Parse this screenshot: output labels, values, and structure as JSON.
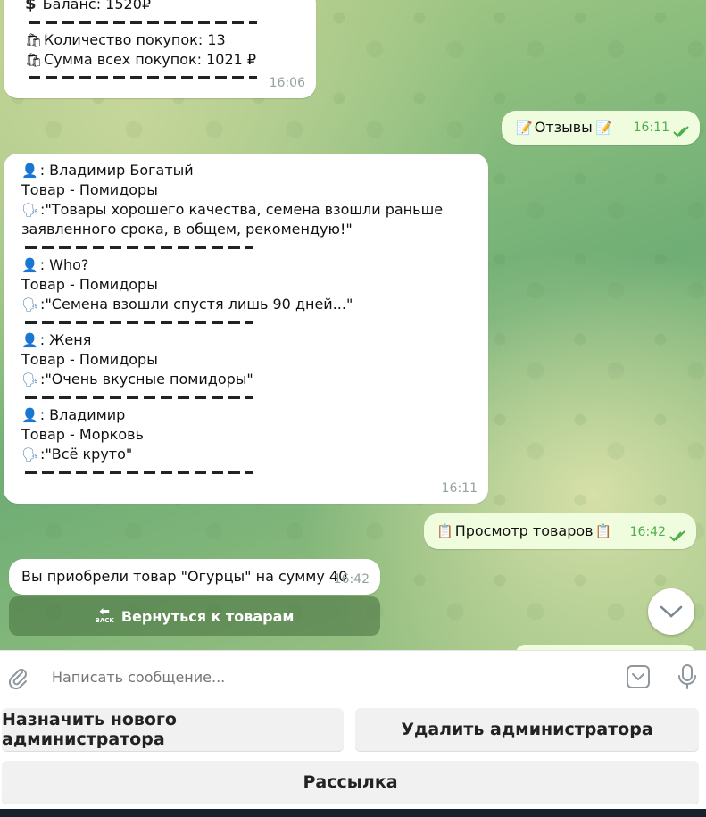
{
  "messages": {
    "balance": {
      "balance_line": "Баланс: 1520₽",
      "purchases_count": "Количество покупок: 13",
      "purchases_sum": "Сумма всех покупок: 1021 ₽",
      "time": "16:06"
    },
    "reviews_cmd": {
      "text": "Отзывы",
      "time": "16:11"
    },
    "reviews": {
      "items": [
        {
          "author": ": Владимир Богатый",
          "product": "Товар - Помидоры",
          "text_line1": ":\"Товары хорошего качества, семена взошли раньше",
          "text_line2": "заявленного срока, в общем, рекомендую!\""
        },
        {
          "author": ": Who?",
          "product": "Товар - Помидоры",
          "text_line1": ":\"Семена взошли спустя лишь 90 дней...\""
        },
        {
          "author": ": Женя",
          "product": "Товар - Помидоры",
          "text_line1": ":\"Очень вкусные помидоры\""
        },
        {
          "author": ": Владимир",
          "product": "Товар - Морковь",
          "text_line1": ":\"Всё круто\""
        }
      ],
      "time": "16:11"
    },
    "view_goods_cmd": {
      "text": "Просмотр товаров",
      "time": "16:42"
    },
    "purchase": {
      "text": "Вы приобрели товар \"Огурцы\" на сумму 40",
      "time": "16:42",
      "button_label": "Вернуться к товарам",
      "button_icon_text": "BACK"
    }
  },
  "input": {
    "placeholder": "Написать сообщение..."
  },
  "keyboard": {
    "assign_admin": "Назначить нового администратора",
    "remove_admin": "Удалить администратора",
    "broadcast": "Рассылка"
  },
  "icons": [
    "dollar-icon",
    "shopping-bags-icon",
    "memo-icon",
    "bust-icon",
    "speaking-head-icon",
    "clipboard-icon",
    "back-arrow-icon",
    "chevron-down-icon",
    "paperclip-icon",
    "command-icon",
    "microphone-icon",
    "double-check-icon"
  ],
  "colors": {
    "accent_green": "#4fae4e",
    "out_bubble": "#effdde",
    "button_bg": "#f1f1f1"
  }
}
